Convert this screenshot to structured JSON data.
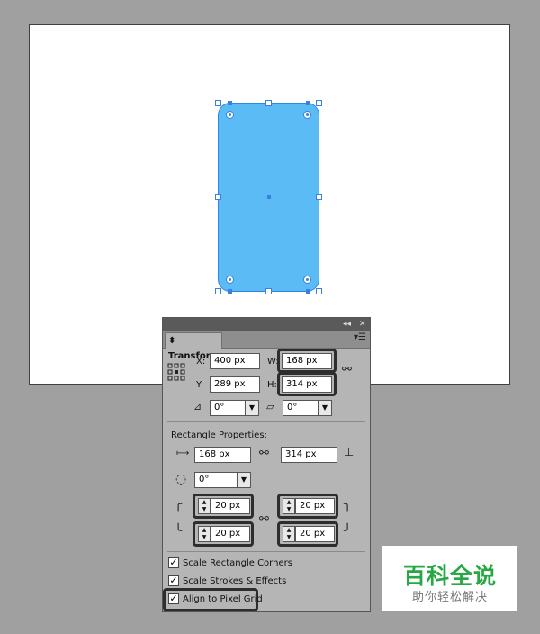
{
  "panel": {
    "collapse_glyph": "◂◂",
    "close_glyph": "✕",
    "tab_label": "Transform",
    "menu_glyph": "▾☰",
    "x_label": "X:",
    "x_value": "400 px",
    "y_label": "Y:",
    "y_value": "289 px",
    "w_label": "W:",
    "w_value": "168 px",
    "h_label": "H:",
    "h_value": "314 px",
    "rotate_value": "0°",
    "shear_value": "0°",
    "rect_props_label": "Rectangle Properties:",
    "rect_width_value": "168 px",
    "rect_height_value": "314 px",
    "rect_rotate_value": "0°",
    "corner_tl": "20 px",
    "corner_tr": "20 px",
    "corner_bl": "20 px",
    "corner_br": "20 px",
    "scale_corners_label": "Scale Rectangle Corners",
    "scale_strokes_label": "Scale Strokes & Effects",
    "align_pixel_label": "Align to Pixel Grid",
    "scale_corners_checked": true,
    "scale_strokes_checked": true,
    "align_pixel_checked": true
  },
  "watermark": {
    "title": "百科全说",
    "subtitle": "助你轻松解决"
  },
  "icons": {
    "reference_point": "reference-point-grid-icon",
    "link": "constrain-proportions-link-icon",
    "rotate": "rotate-angle-icon",
    "shear": "shear-icon",
    "width": "width-arrows-icon",
    "height": "height-arrows-icon",
    "rect_rotate": "rotate-circle-icon",
    "corner_type": "corner-type-icon"
  },
  "colors": {
    "shape_fill": "#5bbcf5",
    "selection": "#3b7fe0",
    "panel_bg": "#b5b5b5",
    "workspace": "#a0a0a0"
  }
}
